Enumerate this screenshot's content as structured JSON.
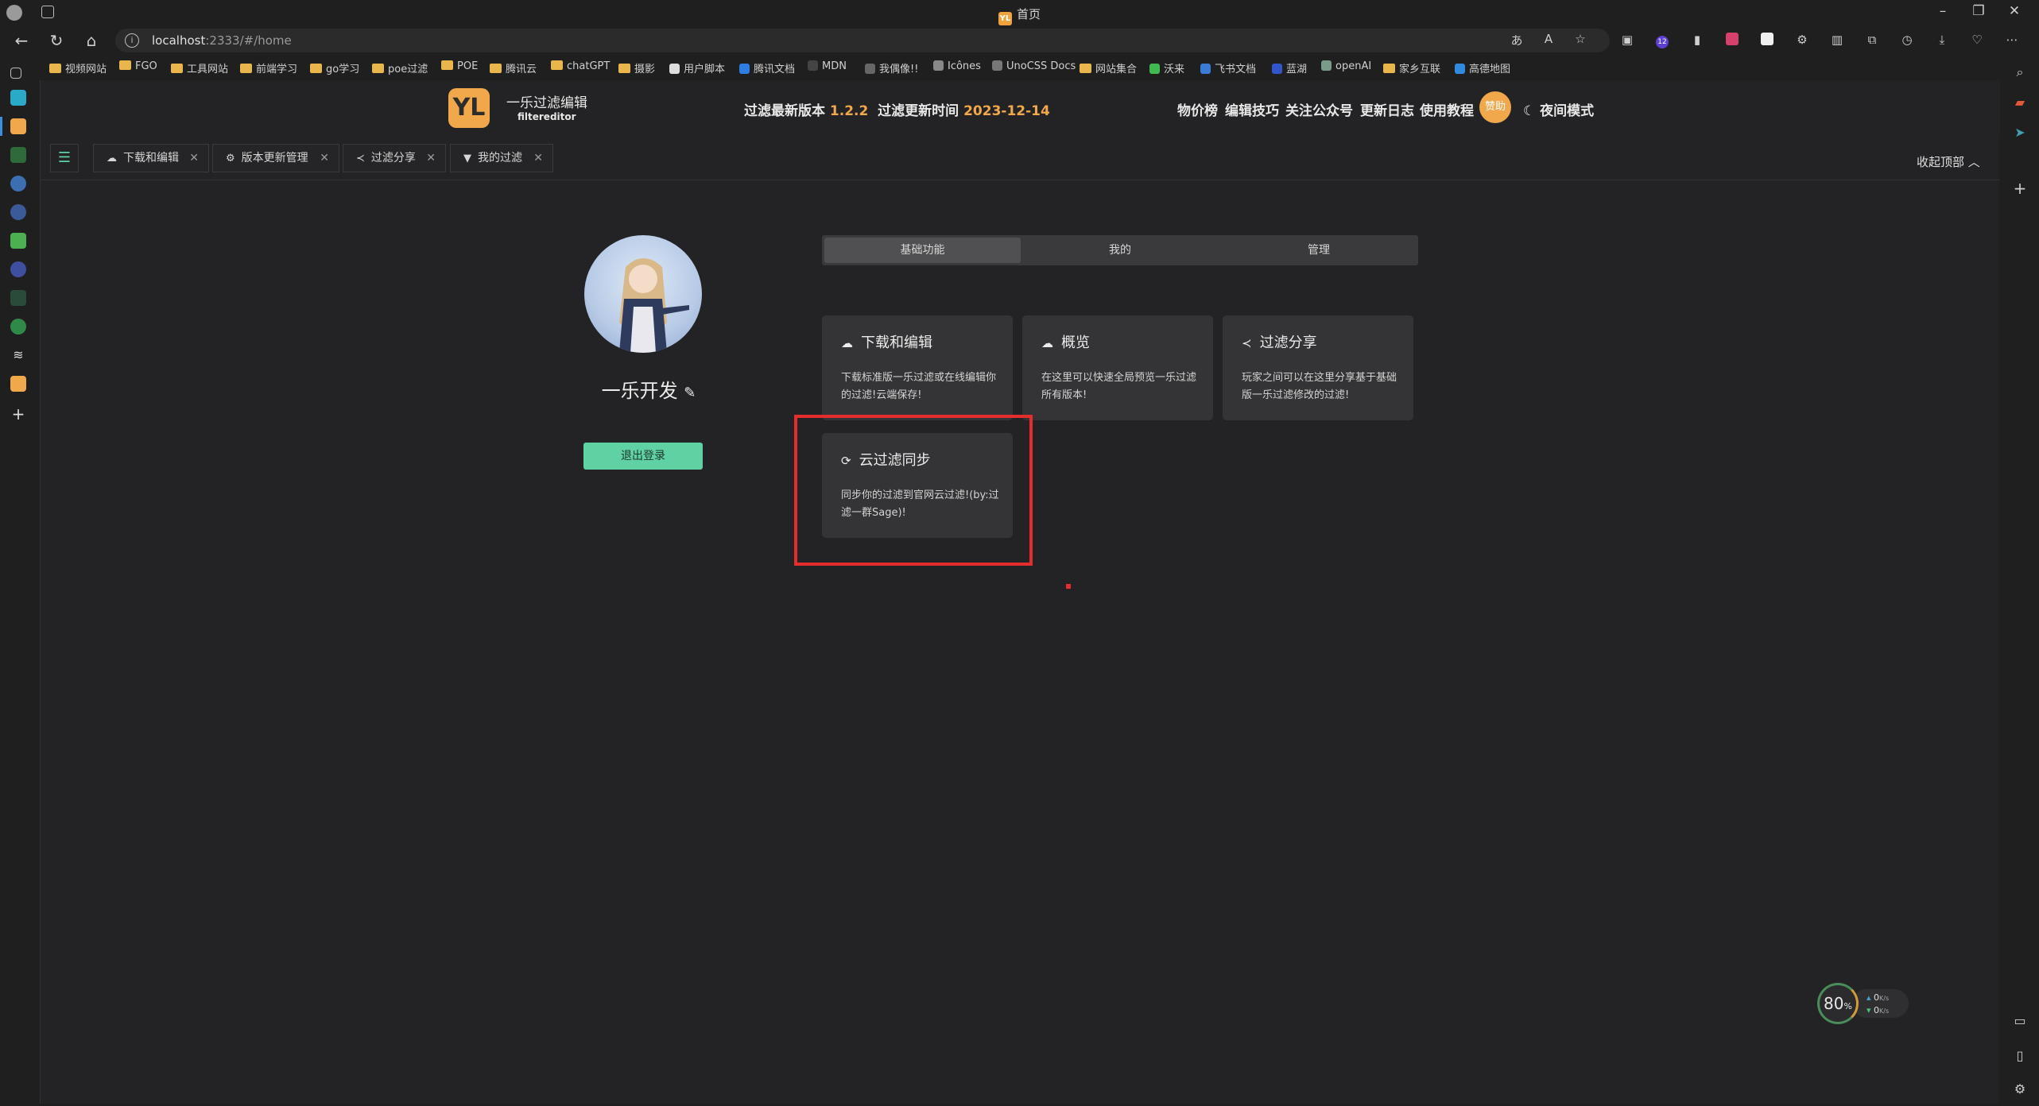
{
  "browser": {
    "window_title": "首页",
    "url_host": "localhost",
    "url_rest": ":2333/#/home",
    "bookmarks": [
      "视频网站",
      "FGO",
      "工具网站",
      "前端学习",
      "go学习",
      "poe过滤",
      "POE",
      "腾讯云",
      "chatGPT",
      "摄影",
      "用户脚本",
      "腾讯文档",
      "MDN",
      "我偶像!!",
      "Icônes",
      "UnoCSS Docs",
      "网站集合",
      "沃来",
      "飞书文档",
      "蓝湖",
      "openAI",
      "家乡互联",
      "高德地图"
    ],
    "extension_badge": "12"
  },
  "app": {
    "logo_text": "YL",
    "brand_name": "一乐过滤编辑",
    "brand_sub": "filtereditor",
    "version_label": "过滤最新版本",
    "version_value": "1.2.2",
    "update_label": "过滤更新时间",
    "update_value": "2023-12-14",
    "nav": [
      "物价榜",
      "编辑技巧",
      "关注公众号",
      "更新日志",
      "使用教程"
    ],
    "sponsor": "赞助",
    "night_mode": "夜间模式"
  },
  "tabs": [
    {
      "label": "下载和编辑",
      "icon": "cloud-icon"
    },
    {
      "label": "版本更新管理",
      "icon": "settings-icon"
    },
    {
      "label": "过滤分享",
      "icon": "share-icon"
    },
    {
      "label": "我的过滤",
      "icon": "filter-icon"
    }
  ],
  "collapse_label": "收起顶部",
  "profile": {
    "username": "一乐开发",
    "logout": "退出登录"
  },
  "segments": [
    "基础功能",
    "我的",
    "管理"
  ],
  "cards": [
    {
      "title": "下载和编辑",
      "desc": "下载标准版一乐过滤或在线编辑你的过滤!云端保存!"
    },
    {
      "title": "概览",
      "desc": "在这里可以快速全局预览一乐过滤所有版本!"
    },
    {
      "title": "过滤分享",
      "desc": "玩家之间可以在这里分享基于基础版一乐过滤修改的过滤!"
    },
    {
      "title": "云过滤同步",
      "desc": "同步你的过滤到官网云过滤!(by:过滤一群Sage)!"
    }
  ],
  "net_widget": {
    "percent": "80",
    "unit": "%",
    "up": "0",
    "down": "0",
    "speed_unit": "K/s"
  },
  "colors": {
    "accent": "#5fd1a3",
    "brand": "#f0a84a",
    "highlight": "#e52d2d"
  }
}
